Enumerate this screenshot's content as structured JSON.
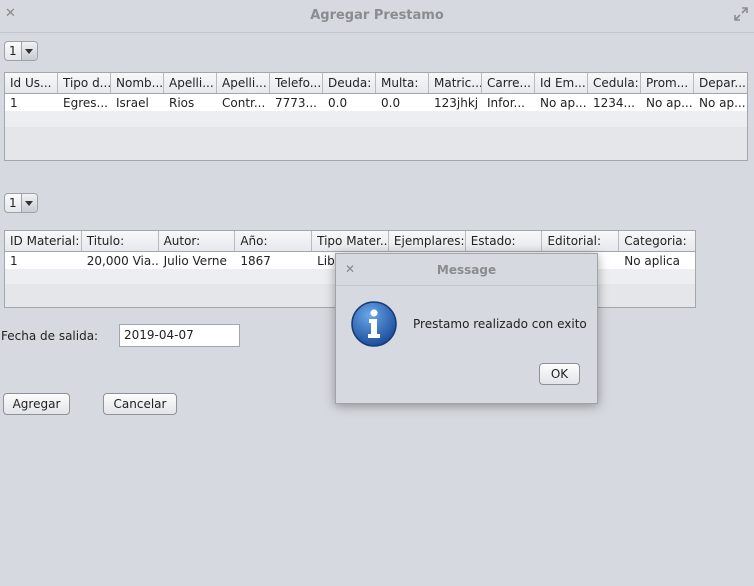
{
  "window": {
    "title": "Agregar Prestamo"
  },
  "combo_top": {
    "value": "1"
  },
  "users_table": {
    "headers": [
      "Id Us...",
      "Tipo d...",
      "Nomb...",
      "Apelli...",
      "Apelli...",
      "Telefo...",
      "Deuda:",
      "Multa:",
      "Matric...",
      "Carre...",
      "Id Em...",
      "Cedula:",
      "Prom...",
      "Depar..."
    ],
    "rows": [
      [
        "1",
        "Egres...",
        "Israel",
        "Rios",
        "Contr...",
        "7773...",
        "0.0",
        "0.0",
        "123jhkj",
        "Infor...",
        "No ap...",
        "1234...",
        "No ap...",
        "No ap..."
      ]
    ]
  },
  "combo_mid": {
    "value": "1"
  },
  "materials_table": {
    "headers": [
      "ID Material:",
      "Titulo:",
      "Autor:",
      "Año:",
      "Tipo Mater...",
      "Ejemplares:",
      "Estado:",
      "Editorial:",
      "Categoria:"
    ],
    "rows": [
      [
        "1",
        "20,000 Via...",
        "Julio Verne",
        "1867",
        "Libro",
        "",
        "",
        "",
        "No aplica"
      ]
    ]
  },
  "form": {
    "fecha_label": "Fecha de salida:",
    "fecha_value": "2019-04-07"
  },
  "buttons": {
    "agregar": "Agregar",
    "cancelar": "Cancelar"
  },
  "dialog": {
    "title": "Message",
    "message": "Prestamo realizado con exito",
    "ok": "OK",
    "icon": "info-icon"
  }
}
